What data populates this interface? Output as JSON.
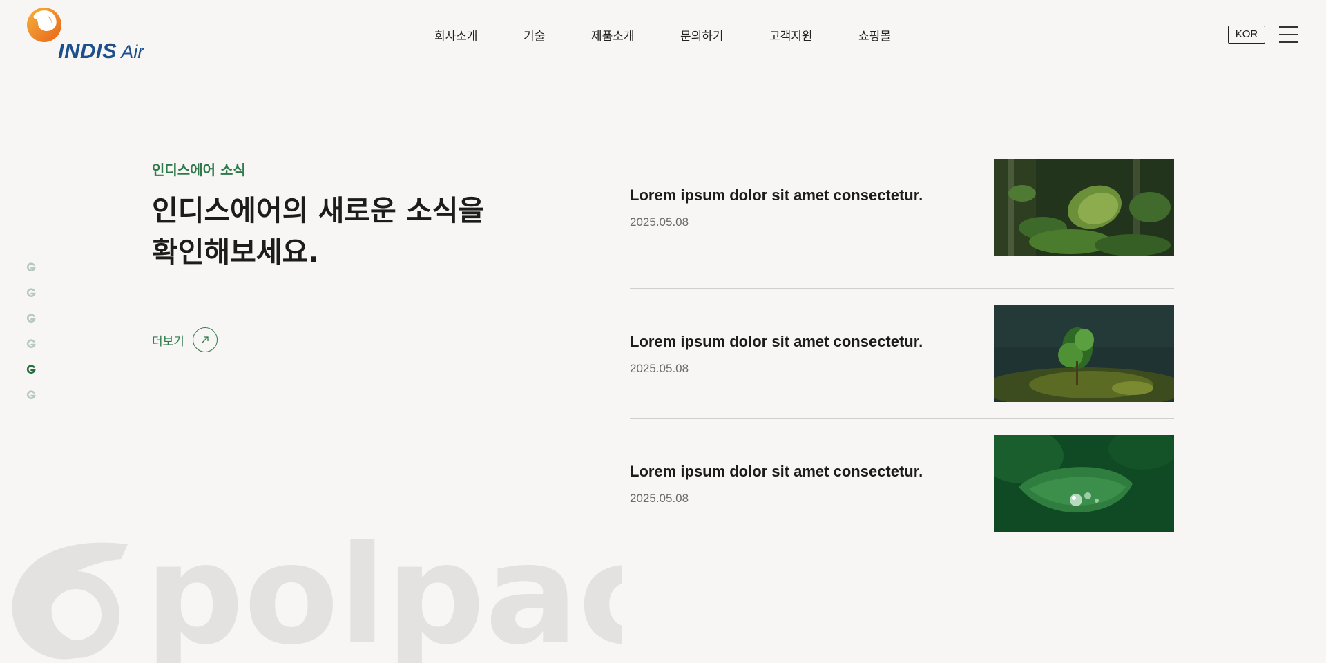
{
  "brand": {
    "name": "INDIS",
    "suffix": "Air"
  },
  "nav": {
    "items": [
      "회사소개",
      "기술",
      "제품소개",
      "문의하기",
      "고객지원",
      "쇼핑몰"
    ]
  },
  "header": {
    "lang_label": "KOR",
    "menu_icon": "hamburger-icon"
  },
  "side_nav": {
    "count": 6,
    "active_index": 4,
    "icon": "g-mark-icon"
  },
  "section": {
    "kicker": "인디스에어 소식",
    "headline_pre": "인디스에어의 ",
    "headline_bold": "새로운 소식",
    "headline_post": "을",
    "headline_line2": "확인해보세요.",
    "more_label": "더보기",
    "more_icon": "arrow-up-right-icon"
  },
  "news": [
    {
      "title": "Lorem ipsum dolor sit amet consectetur.",
      "date": "2025.05.08",
      "image": "jungle-leaves-photo"
    },
    {
      "title": "Lorem ipsum dolor sit amet consectetur.",
      "date": "2025.05.08",
      "image": "sapling-on-moss-photo"
    },
    {
      "title": "Lorem ipsum dolor sit amet consectetur.",
      "date": "2025.05.08",
      "image": "water-drop-leaf-photo"
    }
  ],
  "watermark": {
    "text": "polpack"
  },
  "colors": {
    "background": "#f7f6f4",
    "accent_green": "#2f7a4b",
    "brand_blue": "#1d4f8c",
    "brand_orange": "#f08a1c",
    "divider": "#cfcfcf",
    "watermark": "#e3e2e0"
  }
}
